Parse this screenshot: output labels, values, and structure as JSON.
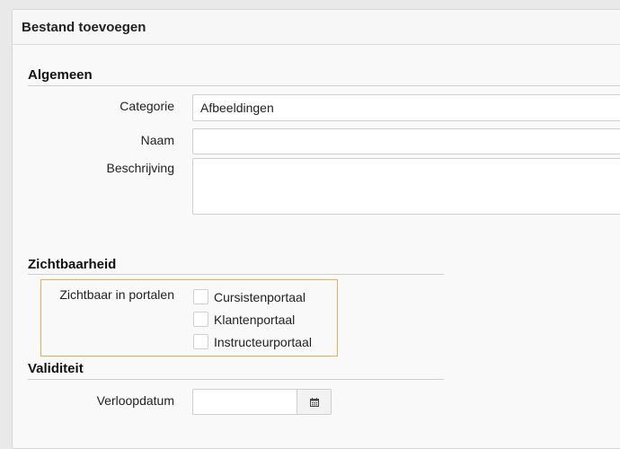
{
  "dialog": {
    "title": "Bestand toevoegen"
  },
  "sections": {
    "general": {
      "title": "Algemeen",
      "category": {
        "label": "Categorie",
        "value": "Afbeeldingen"
      },
      "name": {
        "label": "Naam",
        "value": ""
      },
      "description": {
        "label": "Beschrijving",
        "value": ""
      }
    },
    "visibility": {
      "title": "Zichtbaarheid",
      "field_label": "Zichtbaar in portalen",
      "options": [
        {
          "label": "Cursistenportaal",
          "checked": false
        },
        {
          "label": "Klantenportaal",
          "checked": false
        },
        {
          "label": "Instructeurportaal",
          "checked": false
        }
      ]
    },
    "validity": {
      "title": "Validiteit",
      "expiry": {
        "label": "Verloopdatum",
        "value": "",
        "icon": "calendar-icon"
      }
    }
  },
  "colors": {
    "highlight_border": "#f0ad4e"
  }
}
